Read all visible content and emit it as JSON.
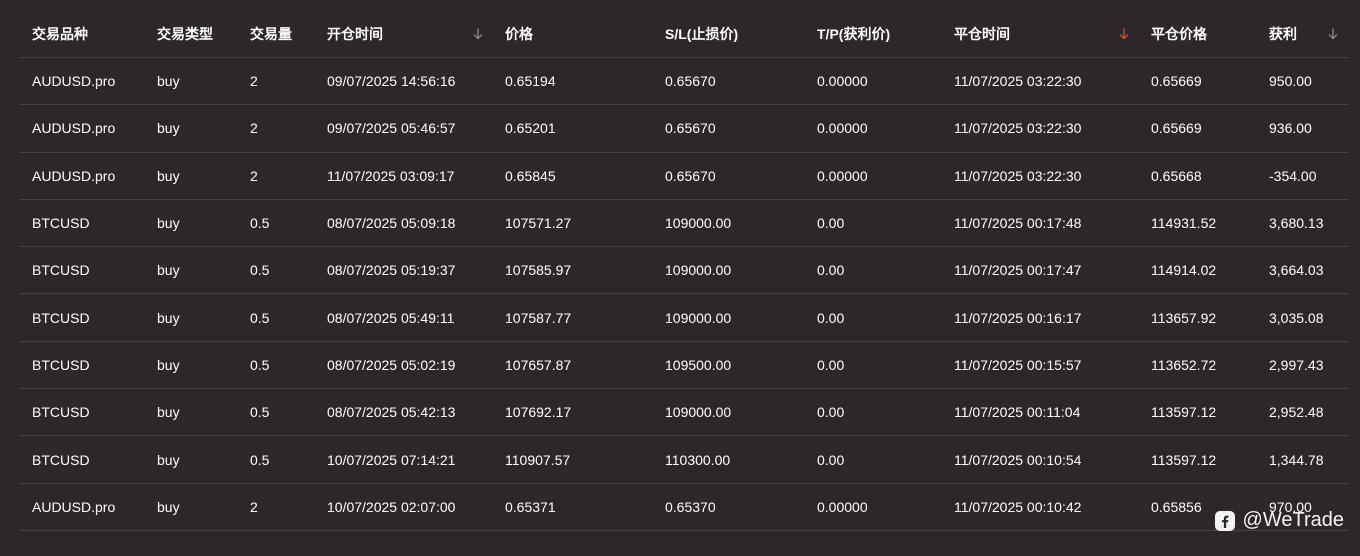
{
  "table": {
    "headers": [
      {
        "label": "交易品种",
        "sort": "none"
      },
      {
        "label": "交易类型",
        "sort": "none"
      },
      {
        "label": "交易量",
        "sort": "none"
      },
      {
        "label": "开仓时间",
        "sort": "desc"
      },
      {
        "label": "价格",
        "sort": "none"
      },
      {
        "label": "S/L(止损价)",
        "sort": "none"
      },
      {
        "label": "T/P(获利价)",
        "sort": "none"
      },
      {
        "label": "平仓时间",
        "sort": "desc-active"
      },
      {
        "label": "平仓价格",
        "sort": "none"
      },
      {
        "label": "获利",
        "sort": "desc"
      }
    ],
    "rows": [
      [
        "AUDUSD.pro",
        "buy",
        "2",
        "09/07/2025 14:56:16",
        "0.65194",
        "0.65670",
        "0.00000",
        "11/07/2025 03:22:30",
        "0.65669",
        "950.00"
      ],
      [
        "AUDUSD.pro",
        "buy",
        "2",
        "09/07/2025 05:46:57",
        "0.65201",
        "0.65670",
        "0.00000",
        "11/07/2025 03:22:30",
        "0.65669",
        "936.00"
      ],
      [
        "AUDUSD.pro",
        "buy",
        "2",
        "11/07/2025 03:09:17",
        "0.65845",
        "0.65670",
        "0.00000",
        "11/07/2025 03:22:30",
        "0.65668",
        "-354.00"
      ],
      [
        "BTCUSD",
        "buy",
        "0.5",
        "08/07/2025 05:09:18",
        "107571.27",
        "109000.00",
        "0.00",
        "11/07/2025 00:17:48",
        "114931.52",
        "3,680.13"
      ],
      [
        "BTCUSD",
        "buy",
        "0.5",
        "08/07/2025 05:19:37",
        "107585.97",
        "109000.00",
        "0.00",
        "11/07/2025 00:17:47",
        "114914.02",
        "3,664.03"
      ],
      [
        "BTCUSD",
        "buy",
        "0.5",
        "08/07/2025 05:49:11",
        "107587.77",
        "109000.00",
        "0.00",
        "11/07/2025 00:16:17",
        "113657.92",
        "3,035.08"
      ],
      [
        "BTCUSD",
        "buy",
        "0.5",
        "08/07/2025 05:02:19",
        "107657.87",
        "109500.00",
        "0.00",
        "11/07/2025 00:15:57",
        "113652.72",
        "2,997.43"
      ],
      [
        "BTCUSD",
        "buy",
        "0.5",
        "08/07/2025 05:42:13",
        "107692.17",
        "109000.00",
        "0.00",
        "11/07/2025 00:11:04",
        "113597.12",
        "2,952.48"
      ],
      [
        "BTCUSD",
        "buy",
        "0.5",
        "10/07/2025 07:14:21",
        "110907.57",
        "110300.00",
        "0.00",
        "11/07/2025 00:10:54",
        "113597.12",
        "1,344.78"
      ],
      [
        "AUDUSD.pro",
        "buy",
        "2",
        "10/07/2025 02:07:00",
        "0.65371",
        "0.65370",
        "0.00000",
        "11/07/2025 00:10:42",
        "0.65856",
        "970.00"
      ]
    ]
  },
  "watermark": {
    "text": "@WeTrade",
    "icon": "facebook-icon"
  },
  "colors": {
    "background": "#2e2729",
    "divider": "#4a4244",
    "sort_inactive": "#9a9395",
    "sort_active": "#e0562a",
    "text": "#ffffff"
  }
}
